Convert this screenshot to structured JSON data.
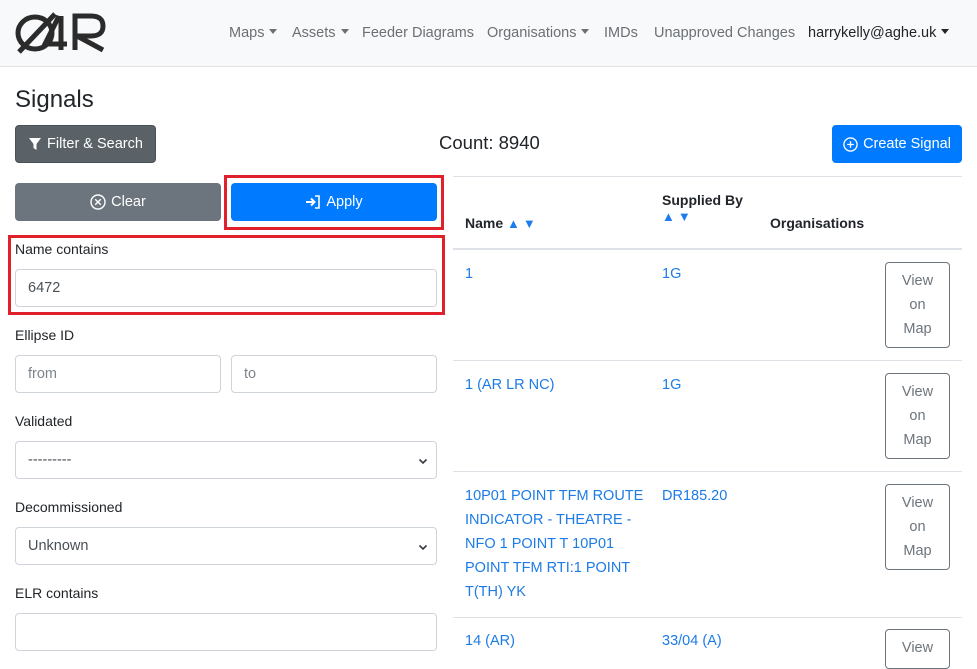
{
  "nav": {
    "logo_alt": "O4R",
    "items": [
      {
        "label": "Maps",
        "dropdown": true
      },
      {
        "label": "Assets",
        "dropdown": true
      },
      {
        "label": "Feeder Diagrams",
        "dropdown": false
      },
      {
        "label": "Organisations",
        "dropdown": true
      },
      {
        "label": "IMDs",
        "dropdown": false
      },
      {
        "label": "Unapproved Changes",
        "dropdown": false
      }
    ],
    "user": "harrykelly@aghe.uk"
  },
  "page": {
    "title": "Signals",
    "filter_button": "Filter & Search",
    "count": "Count: 8940",
    "create_button": "Create Signal"
  },
  "filters": {
    "clear_label": "Clear",
    "apply_label": "Apply",
    "name_contains_label": "Name contains",
    "name_contains_value": "6472",
    "ellipse_id_label": "Ellipse ID",
    "ellipse_from_placeholder": "from",
    "ellipse_to_placeholder": "to",
    "validated_label": "Validated",
    "validated_value": "---------",
    "decommissioned_label": "Decommissioned",
    "decommissioned_value": "Unknown",
    "elr_contains_label": "ELR contains",
    "elr_contains_value": ""
  },
  "table": {
    "columns": {
      "name": "Name",
      "supplied_by": "Supplied By",
      "organisations": "Organisations"
    },
    "sort_arrows": "▲▼",
    "view_button": [
      "View",
      "on",
      "Map"
    ],
    "rows": [
      {
        "name": "1",
        "supplied_by": "1G",
        "organisations": ""
      },
      {
        "name": "1 (AR LR NC)",
        "supplied_by": "1G",
        "organisations": ""
      },
      {
        "name": "10P01 POINT TFM ROUTE INDICATOR - THEATRE - NFO 1 POINT T 10P01 POINT TFM RTI:1 POINT T(TH) YK",
        "supplied_by": "DR185.20",
        "organisations": ""
      },
      {
        "name": "14 (AR)",
        "supplied_by": "33/04 (A)",
        "organisations": ""
      }
    ]
  },
  "colors": {
    "primary": "#007bff",
    "highlight": "#e0202a",
    "link": "#1d7be6"
  }
}
